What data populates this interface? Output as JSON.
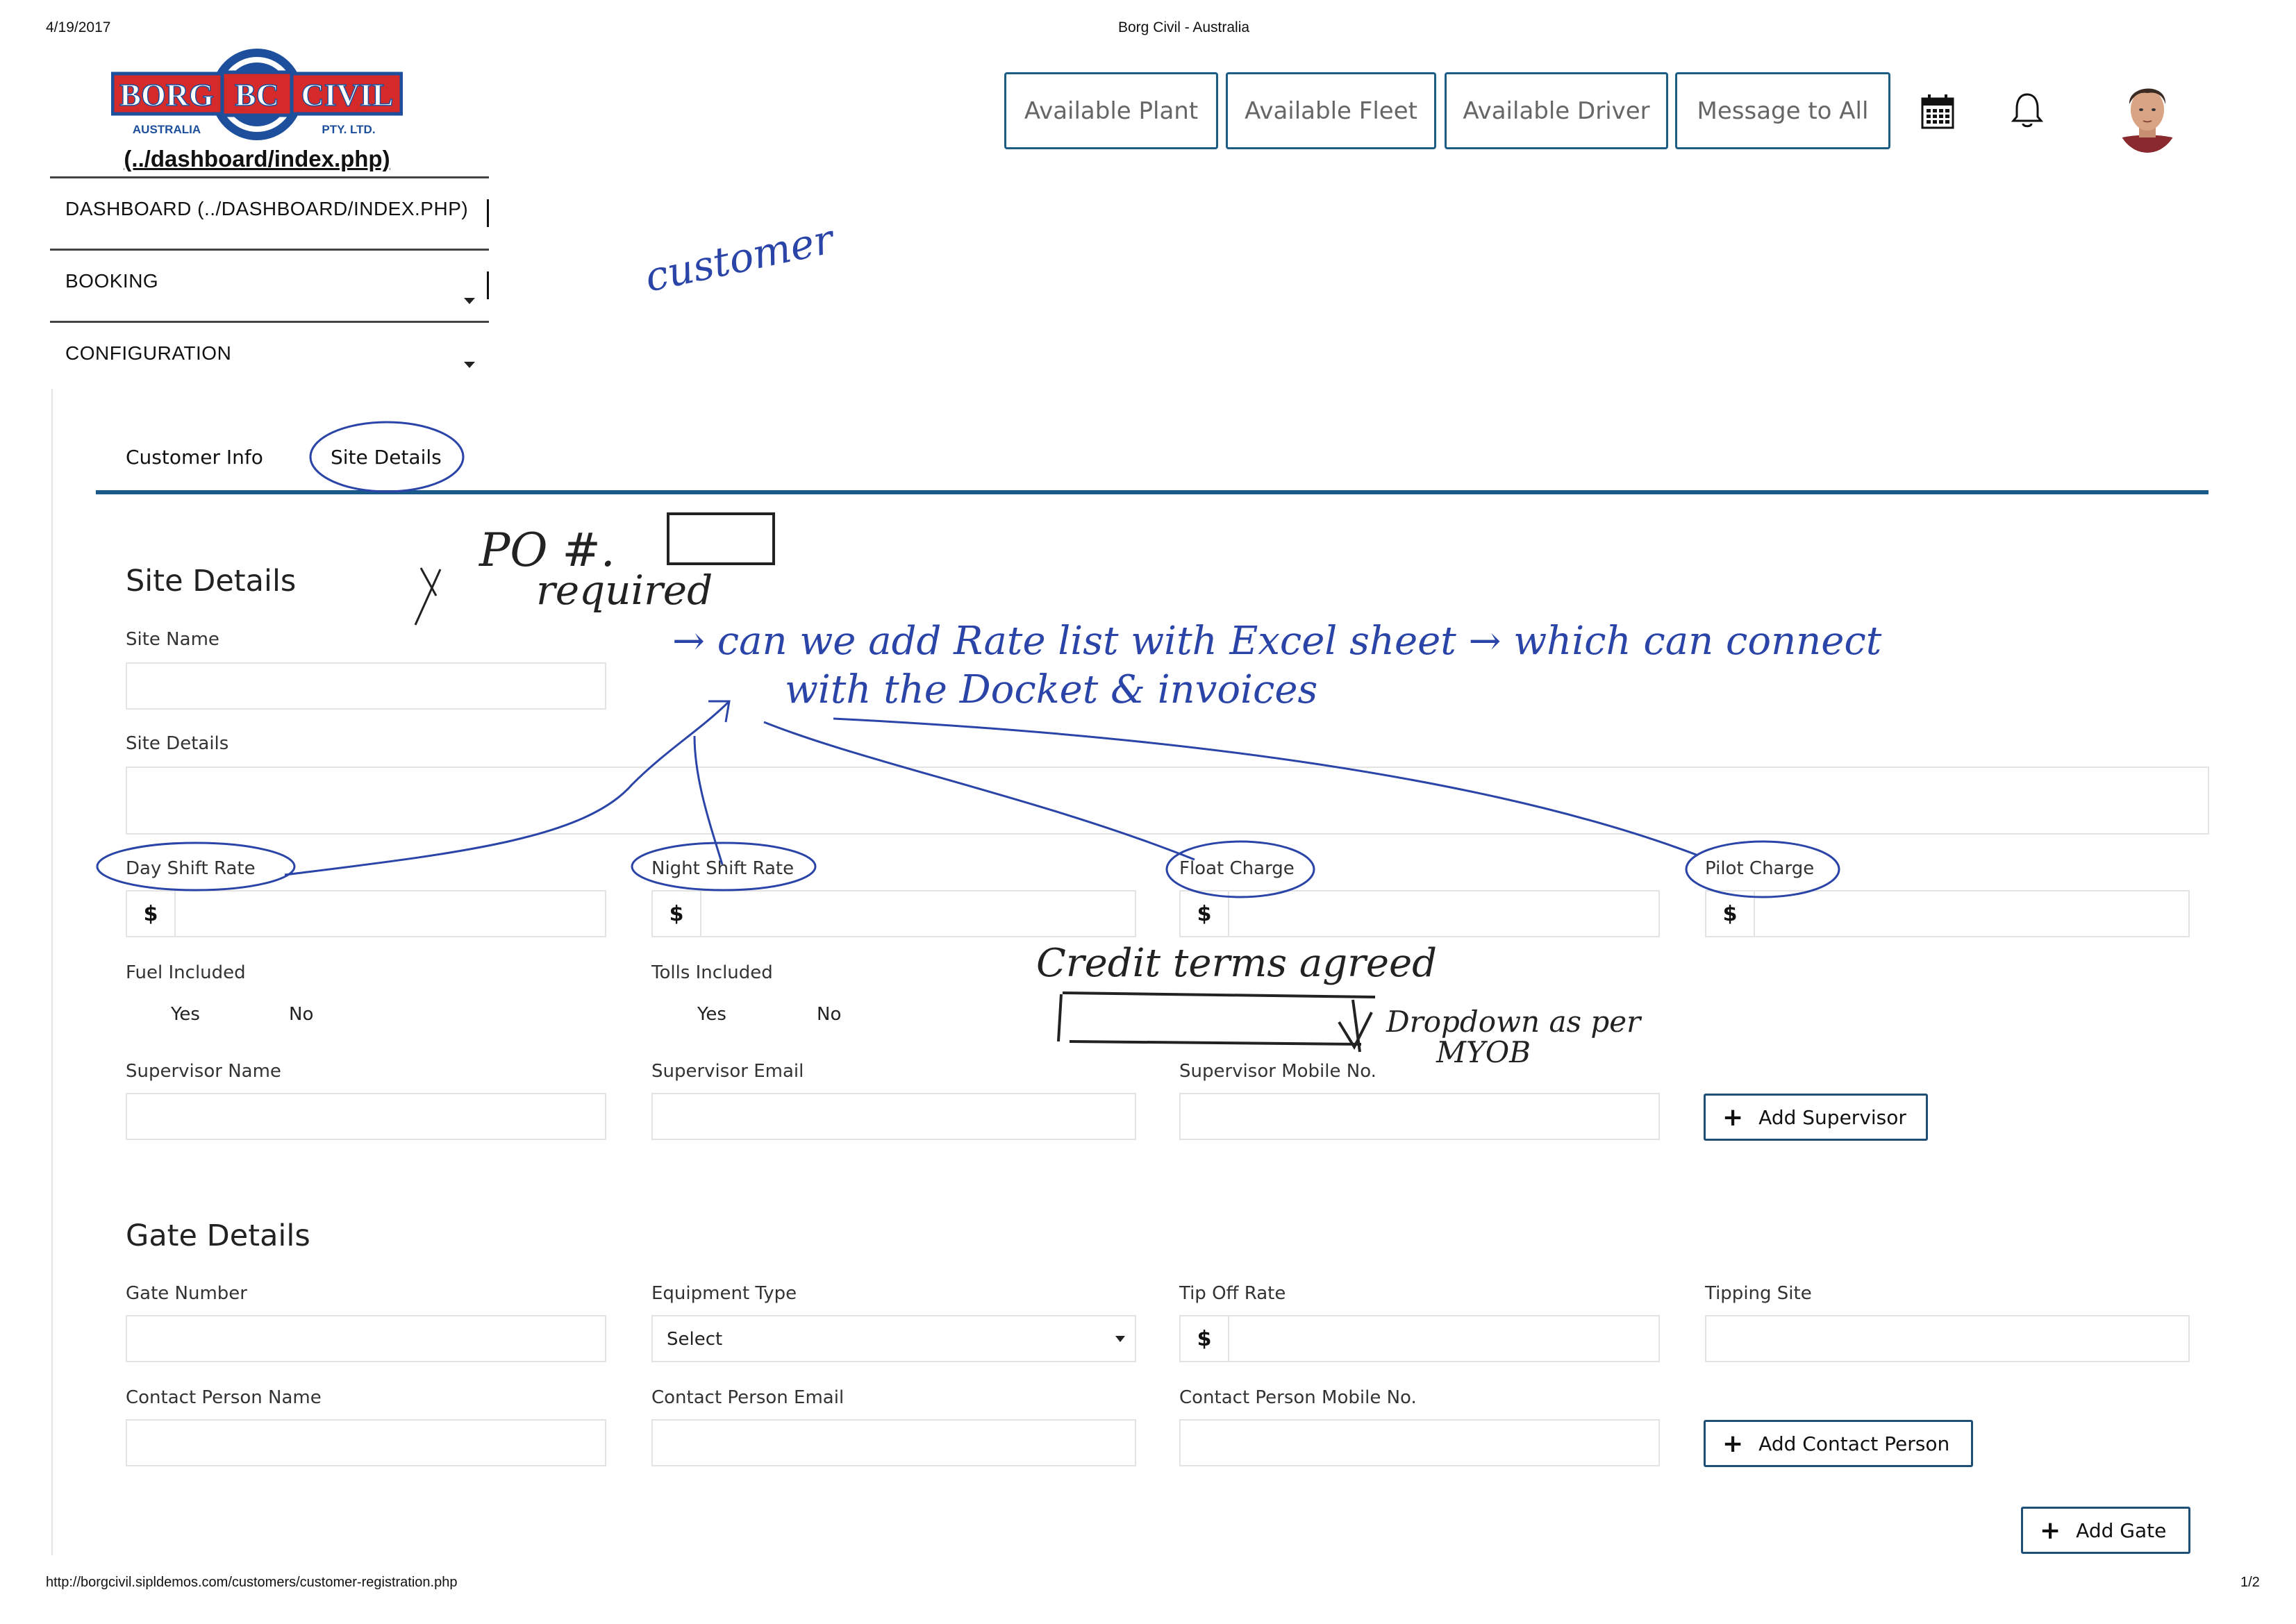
{
  "print_header": {
    "date": "4/19/2017",
    "title": "Borg Civil - Australia",
    "url": "http://borgcivil.sipldemos.com/customers/customer-registration.php",
    "page": "1/2"
  },
  "logo": {
    "brand_left": "BORG",
    "brand_mid": "BC",
    "brand_right": "CIVIL",
    "sub_left": "AUSTRALIA",
    "sub_right": "PTY. LTD.",
    "link_text": "(../dashboard/index.php)"
  },
  "sidebar": {
    "items": [
      {
        "label": "DASHBOARD (../DASHBOARD/INDEX.PHP)"
      },
      {
        "label": "BOOKING"
      },
      {
        "label": "CONFIGURATION"
      }
    ]
  },
  "topbar": {
    "buttons": [
      {
        "label": "Available Plant"
      },
      {
        "label": "Available Fleet"
      },
      {
        "label": "Available Driver"
      },
      {
        "label": "Message to All"
      }
    ],
    "icons": [
      "calendar-icon",
      "bell-icon",
      "user-avatar"
    ]
  },
  "tabs": [
    {
      "label": "Customer Info"
    },
    {
      "label": "Site Details"
    }
  ],
  "site_details": {
    "heading": "Site Details",
    "site_name_label": "Site Name",
    "site_details_label": "Site Details",
    "rates": [
      {
        "label": "Day Shift Rate",
        "prefix": "$"
      },
      {
        "label": "Night Shift Rate",
        "prefix": "$"
      },
      {
        "label": "Float Charge",
        "prefix": "$"
      },
      {
        "label": "Pilot Charge",
        "prefix": "$"
      }
    ],
    "fuel_label": "Fuel Included",
    "tolls_label": "Tolls Included",
    "yes": "Yes",
    "no": "No",
    "supervisor_name_label": "Supervisor Name",
    "supervisor_email_label": "Supervisor Email",
    "supervisor_mobile_label": "Supervisor Mobile No.",
    "add_supervisor": "Add Supervisor"
  },
  "gate_details": {
    "heading": "Gate Details",
    "gate_number_label": "Gate Number",
    "equipment_type_label": "Equipment Type",
    "equipment_type_value": "Select",
    "tip_off_rate_label": "Tip Off Rate",
    "tip_prefix": "$",
    "tipping_site_label": "Tipping Site",
    "contact_name_label": "Contact Person Name",
    "contact_email_label": "Contact Person Email",
    "contact_mobile_label": "Contact Person Mobile No.",
    "add_contact": "Add Contact Person",
    "add_gate": "Add Gate"
  },
  "handwritten": {
    "customer": "customer",
    "po": "PO #.",
    "required": "required",
    "rate_list_line1": "→ can we add Rate list with Excel sheet → which can connect",
    "rate_list_line2": "with the Docket & invoices",
    "credit_terms": "Credit terms agreed",
    "dropdown_note": "Dropdown as per",
    "myob": "MYOB",
    "ink_color": "#2a44a8"
  },
  "colors": {
    "accent": "#1d5c84",
    "tab_underline": "#1a5a8a",
    "logo_red": "#d42a2a",
    "logo_blue": "#1d4f9c"
  }
}
